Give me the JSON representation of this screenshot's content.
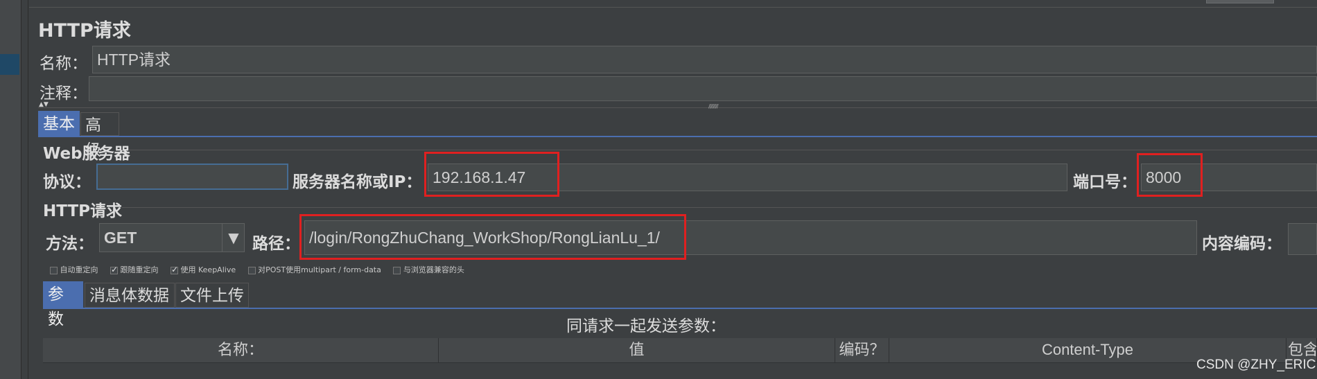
{
  "panel": {
    "title": "HTTP请求",
    "name_label": "名称：",
    "name_value": "HTTP请求",
    "comment_label": "注释：",
    "comment_value": ""
  },
  "tabs_main": [
    {
      "label": "基本",
      "selected": true
    },
    {
      "label": "高级",
      "selected": false
    }
  ],
  "web_server": {
    "section_title": "Web服务器",
    "protocol_label": "协议：",
    "protocol_value": "",
    "server_label": "服务器名称或IP：",
    "server_value": "192.168.1.47",
    "port_label": "端口号：",
    "port_value": "8000"
  },
  "http_request": {
    "section_title": "HTTP请求",
    "method_label": "方法：",
    "method_value": "GET",
    "path_label": "路径：",
    "path_value": "/login/RongZhuChang_WorkShop/RongLianLu_1/",
    "encoding_label": "内容编码："
  },
  "checkboxes": [
    {
      "label": "自动重定向",
      "checked": false
    },
    {
      "label": "跟随重定向",
      "checked": true
    },
    {
      "label": "使用 KeepAlive",
      "checked": true
    },
    {
      "label": "对POST使用multipart / form-data",
      "checked": false
    },
    {
      "label": "与浏览器兼容的头",
      "checked": false
    }
  ],
  "tabs_sub": [
    {
      "label": "参数",
      "selected": true
    },
    {
      "label": "消息体数据",
      "selected": false
    },
    {
      "label": "文件上传",
      "selected": false
    }
  ],
  "params": {
    "caption": "同请求一起发送参数：",
    "columns": [
      "名称：",
      "值",
      "编码？",
      "Content-Type",
      "包含"
    ]
  },
  "watermark": "CSDN @ZHY_ERIC",
  "colors": {
    "accent": "#4b6eaf",
    "highlight": "#e02020",
    "background": "#3c3f41"
  }
}
